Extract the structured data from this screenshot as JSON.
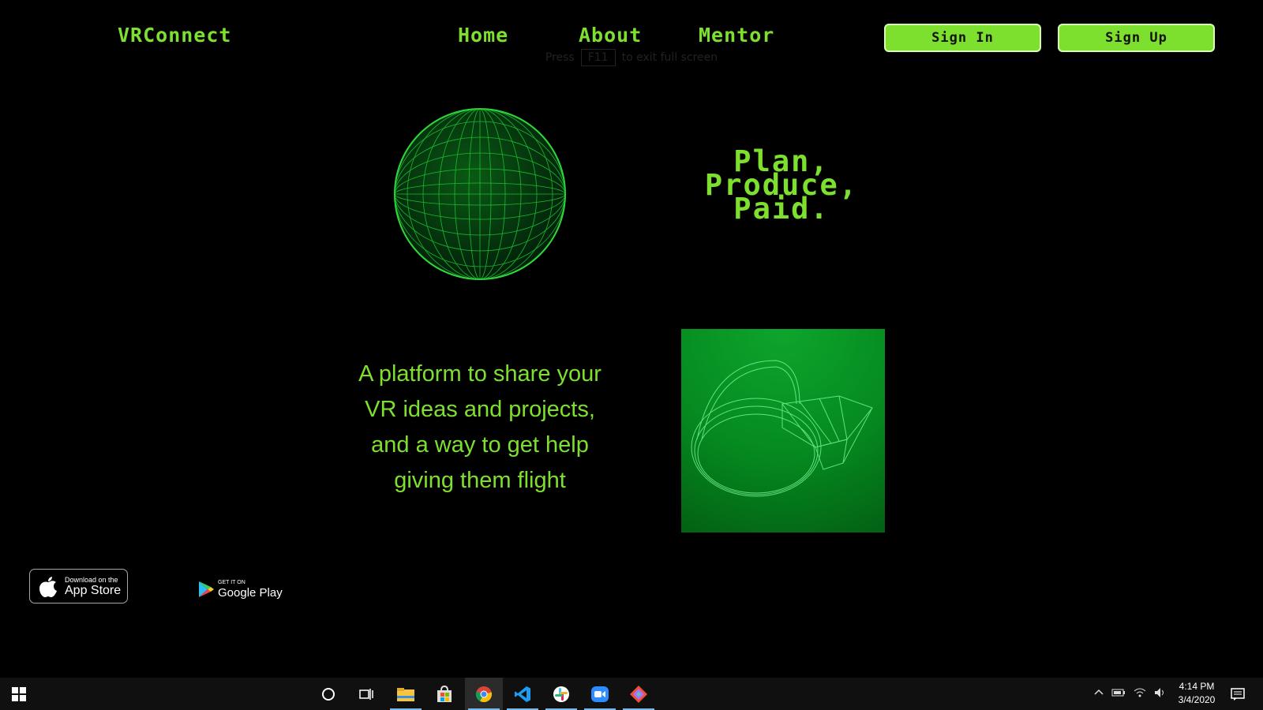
{
  "header": {
    "logo": "VRConnect",
    "nav": [
      "Home",
      "About",
      "Mentor"
    ],
    "sign_in": "Sign In",
    "sign_up": "Sign Up"
  },
  "fullscreen_hint": {
    "prefix": "Press",
    "key": "F11",
    "suffix": "to exit full screen"
  },
  "hero": {
    "headline_lines": [
      "Plan,",
      "Produce,",
      "Paid."
    ],
    "description_lines": [
      "A platform to share your",
      "VR ideas and projects,",
      "and a way to get help",
      "giving them flight"
    ]
  },
  "badges": {
    "apple_small": "Download on the",
    "apple_big": "App Store",
    "google_small": "GET IT ON",
    "google_big": "Google Play"
  },
  "taskbar": {
    "time": "4:14 PM",
    "date": "3/4/2020",
    "apps": [
      "windows-start",
      "cortana",
      "task-view",
      "file-explorer",
      "microsoft-store",
      "chrome",
      "vscode",
      "slack",
      "zoom",
      "git"
    ]
  },
  "colors": {
    "accent": "#7ee02e",
    "background": "#000000",
    "panel_green": "#058a1f"
  }
}
